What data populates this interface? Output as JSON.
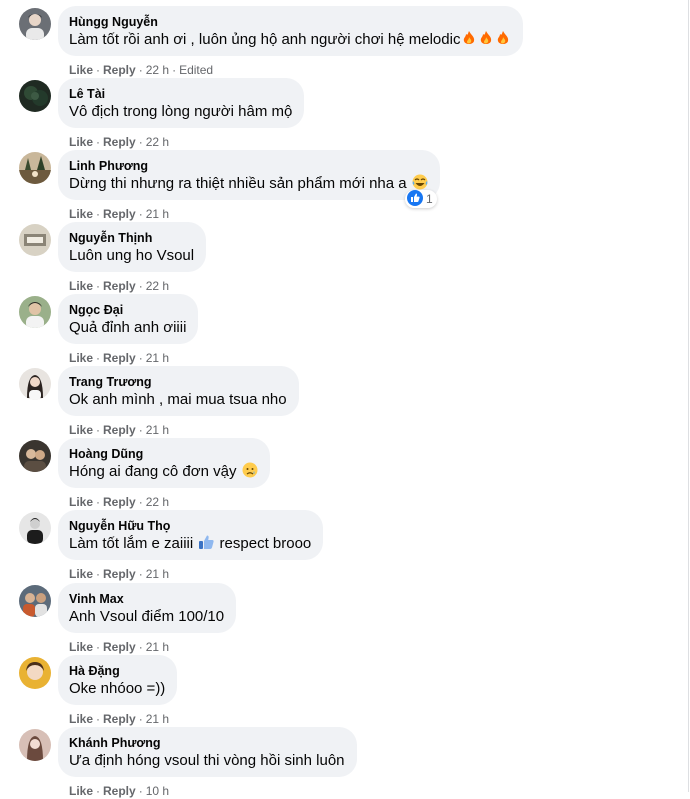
{
  "actions": {
    "like": "Like",
    "reply": "Reply",
    "separator": "·"
  },
  "comments": [
    {
      "author": "Hùngg Nguyễn",
      "text": "Làm tốt rồi anh ơi , luôn ủng hộ anh người chơi hệ melodic",
      "emoji": "fire-x3",
      "time": "22 h",
      "edited": "Edited",
      "avatar": "avatar-photo-1"
    },
    {
      "author": "Lê Tài",
      "text": "Vô địch trong lòng người hâm mộ",
      "time": "22 h",
      "avatar": "avatar-photo-2"
    },
    {
      "author": "Linh Phương",
      "text": "Dừng thi nhưng ra thiệt nhiều sản phẩm mới nha a",
      "emoji": "laughing-emoji",
      "time": "21 h",
      "reaction_count": "1",
      "avatar": "avatar-photo-3"
    },
    {
      "author": "Nguyễn Thịnh",
      "text": "Luôn ung ho Vsoul",
      "time": "22 h",
      "avatar": "avatar-photo-4"
    },
    {
      "author": "Ngọc Đại",
      "text": "Quả đỉnh anh ơiiii",
      "time": "21 h",
      "avatar": "avatar-photo-5"
    },
    {
      "author": "Trang Trương",
      "text": "Ok anh mình , mai mua tsua nho",
      "time": "21 h",
      "avatar": "avatar-photo-6"
    },
    {
      "author": "Hoàng Dũng",
      "text": "Hóng ai đang cô đơn vậy",
      "emoji": "sad-emoji",
      "time": "22 h",
      "avatar": "avatar-photo-7"
    },
    {
      "author": "Nguyễn Hữu Thọ",
      "text_before": "Làm tốt lắm e zaiiii",
      "text_after": " respect brooo",
      "emoji": "thumbs-up-emoji",
      "time": "21 h",
      "avatar": "avatar-photo-8"
    },
    {
      "author": "Vinh Max",
      "text": "Anh Vsoul điểm 100/10",
      "time": "21 h",
      "avatar": "avatar-photo-9"
    },
    {
      "author": "Hà Đặng",
      "text": "Oke nhóoo =))",
      "time": "21 h",
      "avatar": "avatar-photo-10"
    },
    {
      "author": "Khánh Phương",
      "text": "Ưa định hóng vsoul thi vòng hồi sinh luôn",
      "time": "10 h",
      "avatar": "avatar-photo-11"
    }
  ],
  "colors": {
    "bubble": "#f0f2f5",
    "meta": "#65676b",
    "text": "#050505",
    "like_blue": "#1877f2"
  }
}
